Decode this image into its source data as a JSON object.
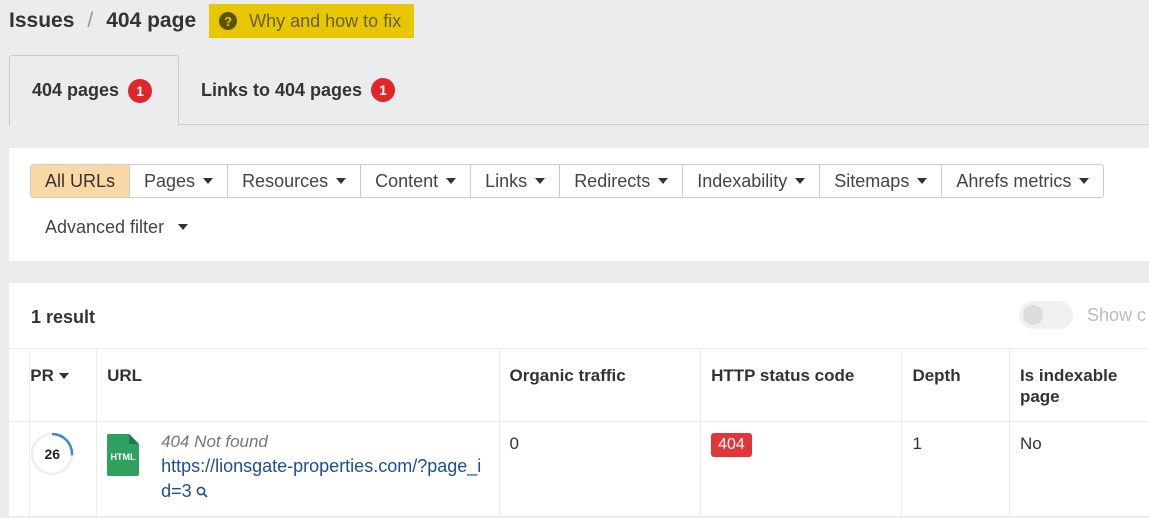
{
  "header": {
    "breadcrumb_root": "Issues",
    "separator": "/",
    "breadcrumb_current": "404 page",
    "fix_button_label": "Why and how to fix",
    "fix_button_icon": "question-circle-icon"
  },
  "tabs": [
    {
      "label": "404 pages",
      "count": "1",
      "active": true
    },
    {
      "label": "Links to 404 pages",
      "count": "1",
      "active": false
    }
  ],
  "filters": {
    "segments": [
      {
        "label": "All URLs",
        "active": true,
        "dropdown": false
      },
      {
        "label": "Pages",
        "dropdown": true
      },
      {
        "label": "Resources",
        "dropdown": true
      },
      {
        "label": "Content",
        "dropdown": true
      },
      {
        "label": "Links",
        "dropdown": true
      },
      {
        "label": "Redirects",
        "dropdown": true
      },
      {
        "label": "Indexability",
        "dropdown": true
      },
      {
        "label": "Sitemaps",
        "dropdown": true
      },
      {
        "label": "Ahrefs metrics",
        "dropdown": true
      }
    ],
    "advanced_filter_label": "Advanced filter"
  },
  "results": {
    "count_label": "1 result",
    "toggle_label": "Show c",
    "toggle_on": false,
    "columns": [
      "PR",
      "URL",
      "Organic traffic",
      "HTTP status code",
      "Depth",
      "Is indexable page"
    ],
    "sort_column": "PR",
    "rows": [
      {
        "pr": "26",
        "pr_fraction": 0.26,
        "file_type": "HTML",
        "status_text": "404 Not found",
        "url": "https://lionsgate-properties.com/?page_id=3",
        "organic_traffic": "0",
        "http_status_code": "404",
        "depth": "1",
        "is_indexable": "No"
      }
    ]
  },
  "colors": {
    "fix_button_bg": "#e8c700",
    "badge_red": "#e1262b",
    "active_segment": "#fbd9a6",
    "link_blue": "#1a4ea0",
    "html_icon_green": "#2ea160",
    "pr_ring_blue": "#3b87d4"
  }
}
